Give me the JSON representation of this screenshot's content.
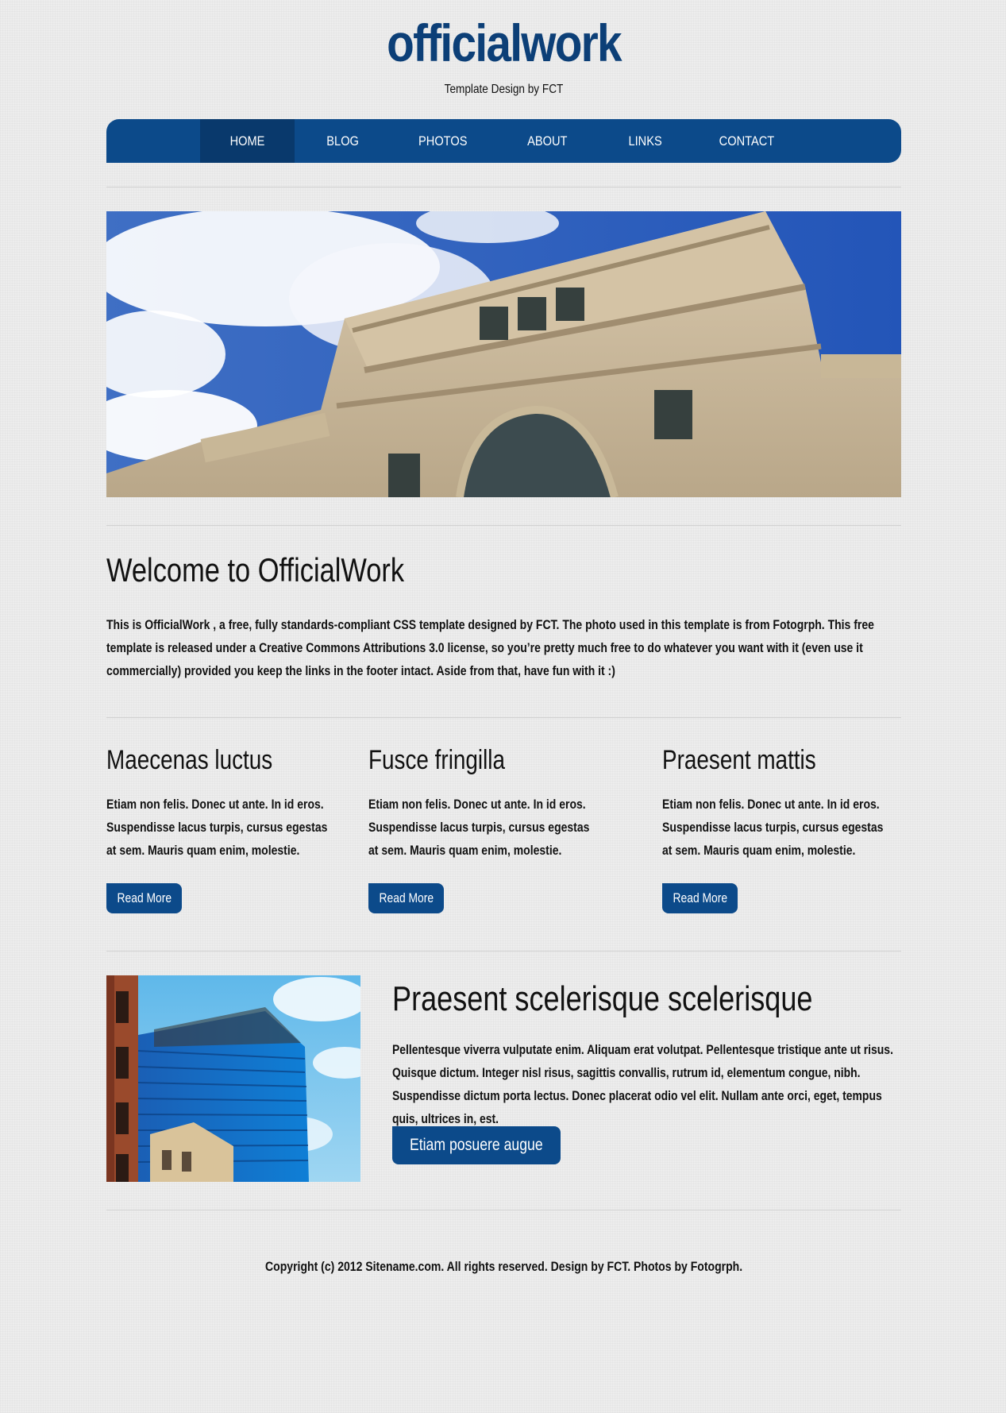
{
  "header": {
    "logo": "officialwork",
    "tagline": "Template Design by FCT"
  },
  "nav": {
    "items": [
      "HOME",
      "BLOG",
      "PHOTOS",
      "ABOUT",
      "LINKS",
      "CONTACT"
    ],
    "active": "HOME"
  },
  "intro": {
    "title": "Welcome to OfficialWork",
    "text": "This is OfficialWork , a free, fully standards-compliant CSS template designed by FCT. The photo used in this template is from Fotogrph. This free template is released under a Creative Commons Attributions 3.0 license, so you’re pretty much free to do whatever you want with it (even use it commercially) provided you keep the links in the footer intact. Aside from that, have fun with it :)"
  },
  "columns": [
    {
      "title": "Maecenas luctus",
      "text": "Etiam non felis. Donec ut ante. In id eros. Suspendisse lacus turpis, cursus egestas at sem. Mauris quam enim, molestie.",
      "button": "Read More"
    },
    {
      "title": "Fusce fringilla",
      "text": "Etiam non felis. Donec ut ante. In id eros. Suspendisse lacus turpis, cursus egestas at sem. Mauris quam enim, molestie.",
      "button": "Read More"
    },
    {
      "title": "Praesent mattis",
      "text": "Etiam non felis. Donec ut ante. In id eros. Suspendisse lacus turpis, cursus egestas at sem. Mauris quam enim, molestie.",
      "button": "Read More"
    }
  ],
  "feature": {
    "title": "Praesent scelerisque scelerisque",
    "text": "Pellentesque viverra vulputate enim. Aliquam erat volutpat. Pellentesque tristique ante ut risus. Quisque dictum. Integer nisl risus, sagittis convallis, rutrum id, elementum congue, nibh. Suspendisse dictum porta lectus. Donec placerat odio vel elit. Nullam ante orci, eget, tempus quis, ultrices in, est.",
    "button": "Etiam posuere augue"
  },
  "footer": {
    "text": "Copyright (c) 2012 Sitename.com. All rights reserved. Design by FCT. Photos by Fotogrph."
  },
  "colors": {
    "brand": "#0c4a8a",
    "logo": "#0c3f77",
    "background": "#ededed"
  }
}
